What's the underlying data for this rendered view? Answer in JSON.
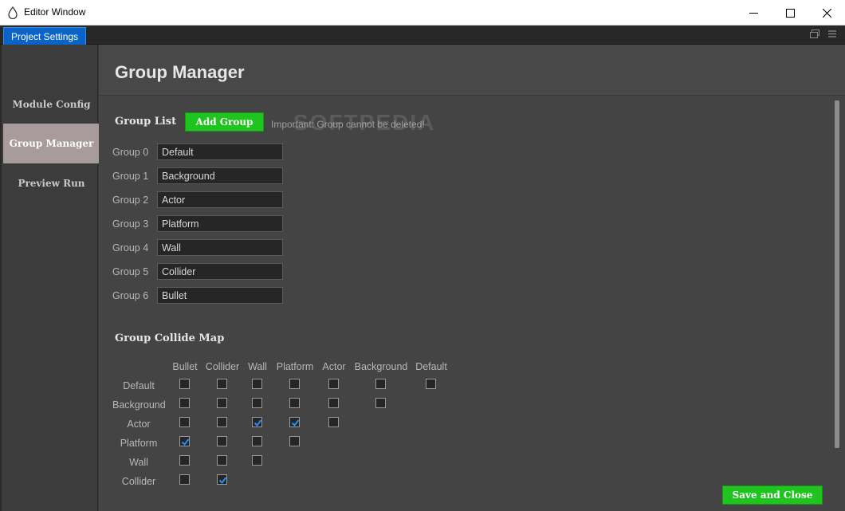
{
  "window": {
    "title": "Editor Window",
    "icons": {
      "app": "droplet-icon",
      "minimize": "minimize-icon",
      "maximize": "maximize-icon",
      "close": "close-icon"
    }
  },
  "tabs": [
    {
      "label": "Project Settings",
      "active": true
    }
  ],
  "tab_icons": [
    "restore-icon",
    "menu-icon"
  ],
  "sidebar": {
    "items": [
      {
        "label": "Module Config",
        "active": false
      },
      {
        "label": "Group Manager",
        "active": true
      },
      {
        "label": "Preview Run",
        "active": false
      }
    ]
  },
  "page": {
    "title": "Group Manager"
  },
  "group_list": {
    "title": "Group List",
    "add_button": "Add Group",
    "note": "Important: Group cannot be deleted!",
    "groups": [
      {
        "label": "Group 0",
        "value": "Default"
      },
      {
        "label": "Group 1",
        "value": "Background"
      },
      {
        "label": "Group 2",
        "value": "Actor"
      },
      {
        "label": "Group 3",
        "value": "Platform"
      },
      {
        "label": "Group 4",
        "value": "Wall"
      },
      {
        "label": "Group 5",
        "value": "Collider"
      },
      {
        "label": "Group 6",
        "value": "Bullet"
      }
    ]
  },
  "collide_map": {
    "title": "Group Collide Map",
    "columns": [
      "Bullet",
      "Collider",
      "Wall",
      "Platform",
      "Actor",
      "Background",
      "Default"
    ],
    "rows": [
      {
        "label": "Default",
        "checks": [
          false,
          false,
          false,
          false,
          false,
          false,
          false
        ]
      },
      {
        "label": "Background",
        "checks": [
          false,
          false,
          false,
          false,
          false,
          false
        ]
      },
      {
        "label": "Actor",
        "checks": [
          false,
          false,
          true,
          true,
          false
        ]
      },
      {
        "label": "Platform",
        "checks": [
          true,
          false,
          false,
          false
        ]
      },
      {
        "label": "Wall",
        "checks": [
          false,
          false,
          false
        ]
      },
      {
        "label": "Collider",
        "checks": [
          false,
          true
        ]
      }
    ]
  },
  "footer": {
    "save_button": "Save and Close"
  },
  "watermark": "SOFTPEDIA",
  "colors": {
    "accent_tab": "#0a64c8",
    "button_green": "#1fc41f",
    "active_sidebar": "#a89b9b",
    "check_blue": "#1e90ff"
  }
}
